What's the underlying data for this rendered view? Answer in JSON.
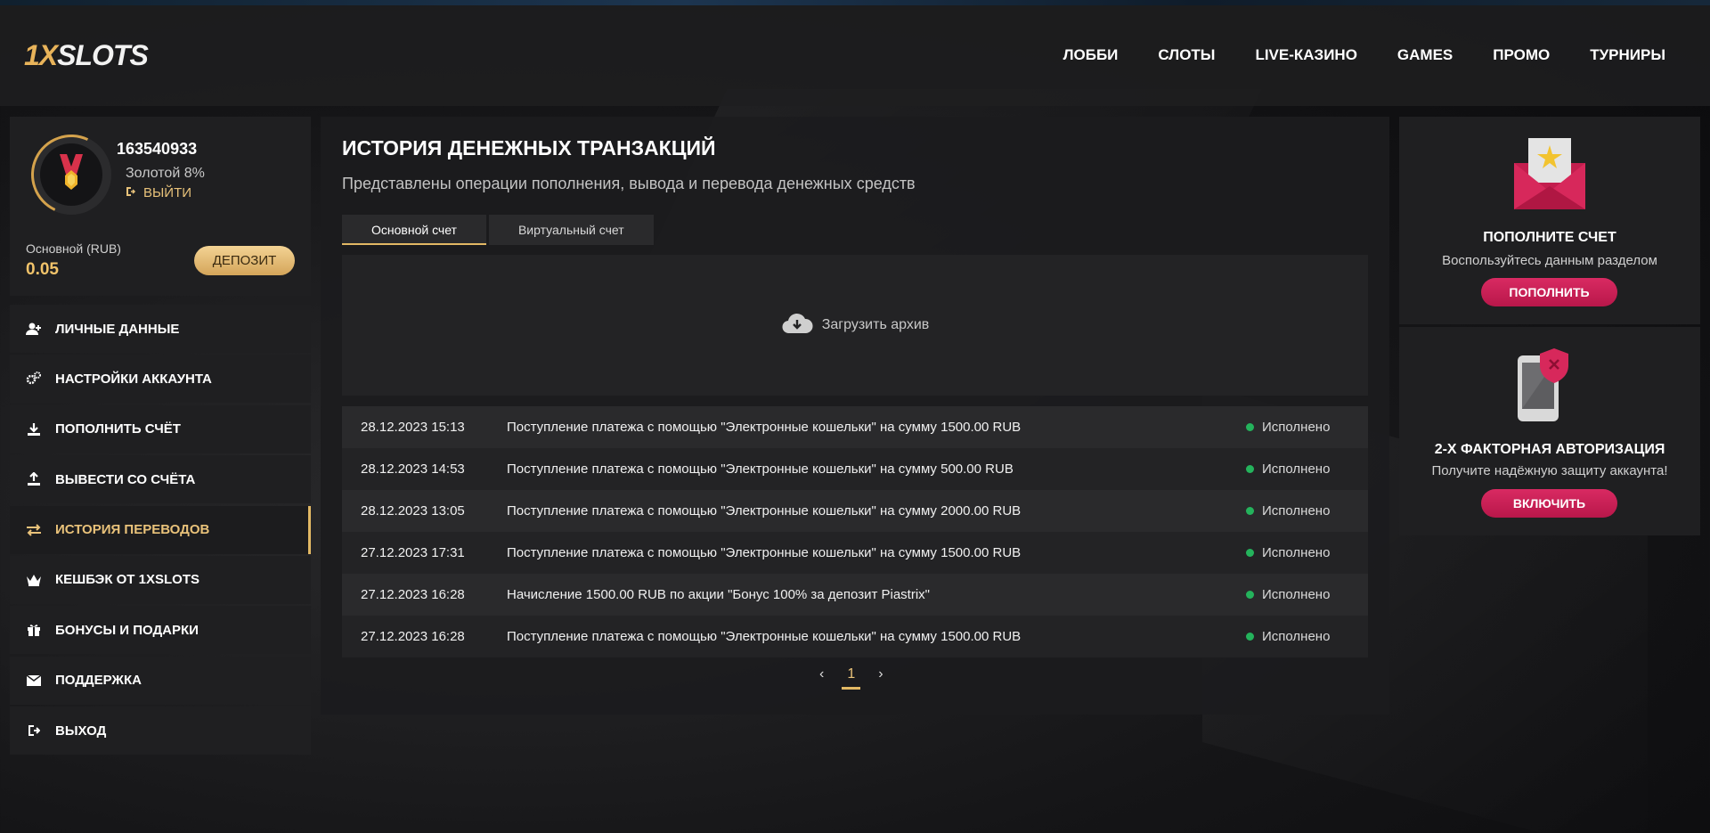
{
  "header": {
    "logo_part1": "1X",
    "logo_part2": "SLOTS",
    "nav": [
      "ЛОББИ",
      "СЛОТЫ",
      "LIVE-КАЗИНО",
      "GAMES",
      "ПРОМО",
      "ТУРНИРЫ"
    ]
  },
  "profile": {
    "user_id": "163540933",
    "status": "Золотой 8%",
    "logout_label": "ВЫЙТИ",
    "account_label": "Основной (RUB)",
    "balance": "0.05",
    "deposit_label": "ДЕПОЗИТ"
  },
  "menu": [
    {
      "label": "ЛИЧНЫЕ ДАННЫЕ",
      "icon": "user-plus-icon"
    },
    {
      "label": "НАСТРОЙКИ АККАУНТА",
      "icon": "gears-icon"
    },
    {
      "label": "ПОПОЛНИТЬ СЧЁТ",
      "icon": "download-icon"
    },
    {
      "label": "ВЫВЕСТИ СО СЧЁТА",
      "icon": "upload-icon"
    },
    {
      "label": "ИСТОРИЯ ПЕРЕВОДОВ",
      "icon": "transfer-arrows-icon"
    },
    {
      "label": "КЕШБЭК ОТ 1XSLOTS",
      "icon": "crown-icon"
    },
    {
      "label": "БОНУСЫ И ПОДАРКИ",
      "icon": "gift-icon"
    },
    {
      "label": "ПОДДЕРЖКА",
      "icon": "envelope-icon"
    },
    {
      "label": "ВЫХОД",
      "icon": "exit-icon"
    }
  ],
  "main": {
    "title": "ИСТОРИЯ ДЕНЕЖНЫХ ТРАНЗАКЦИЙ",
    "subtitle": "Представлены операции пополнения, вывода и перевода денежных средств",
    "tabs": [
      {
        "label": "Основной счет"
      },
      {
        "label": "Виртуальный счет"
      }
    ],
    "archive_label": "Загрузить архив",
    "transactions": [
      {
        "date": "28.12.2023 15:13",
        "description": "Поступление платежа с помощью \"Электронные кошельки\" на сумму 1500.00 RUB",
        "status": "Исполнено"
      },
      {
        "date": "28.12.2023 14:53",
        "description": "Поступление платежа с помощью \"Электронные кошельки\" на сумму 500.00 RUB",
        "status": "Исполнено"
      },
      {
        "date": "28.12.2023 13:05",
        "description": "Поступление платежа с помощью \"Электронные кошельки\" на сумму 2000.00 RUB",
        "status": "Исполнено"
      },
      {
        "date": "27.12.2023 17:31",
        "description": "Поступление платежа с помощью \"Электронные кошельки\" на сумму 1500.00 RUB",
        "status": "Исполнено"
      },
      {
        "date": "27.12.2023 16:28",
        "description": "Начисление 1500.00 RUB по акции \"Бонус 100% за депозит Piastrix\"",
        "status": "Исполнено"
      },
      {
        "date": "27.12.2023 16:28",
        "description": "Поступление платежа с помощью \"Электронные кошельки\" на сумму 1500.00 RUB",
        "status": "Исполнено"
      }
    ],
    "pager": {
      "prev": "‹",
      "page": "1",
      "next": "›"
    }
  },
  "promos": [
    {
      "title": "ПОПОЛНИТЕ СЧЕТ",
      "text": "Воспользуйтесь данным разделом",
      "button": "ПОПОЛНИТЬ",
      "icon": "envelope-star-icon"
    },
    {
      "title": "2-Х ФАКТОРНАЯ АВТОРИЗАЦИЯ",
      "text": "Получите надёжную защиту аккаунта!",
      "button": "ВКЛЮЧИТЬ",
      "icon": "phone-shield-icon"
    }
  ],
  "colors": {
    "accent_gold": "#e2b864",
    "accent_pink": "#d92a62",
    "status_green": "#24b35c"
  }
}
